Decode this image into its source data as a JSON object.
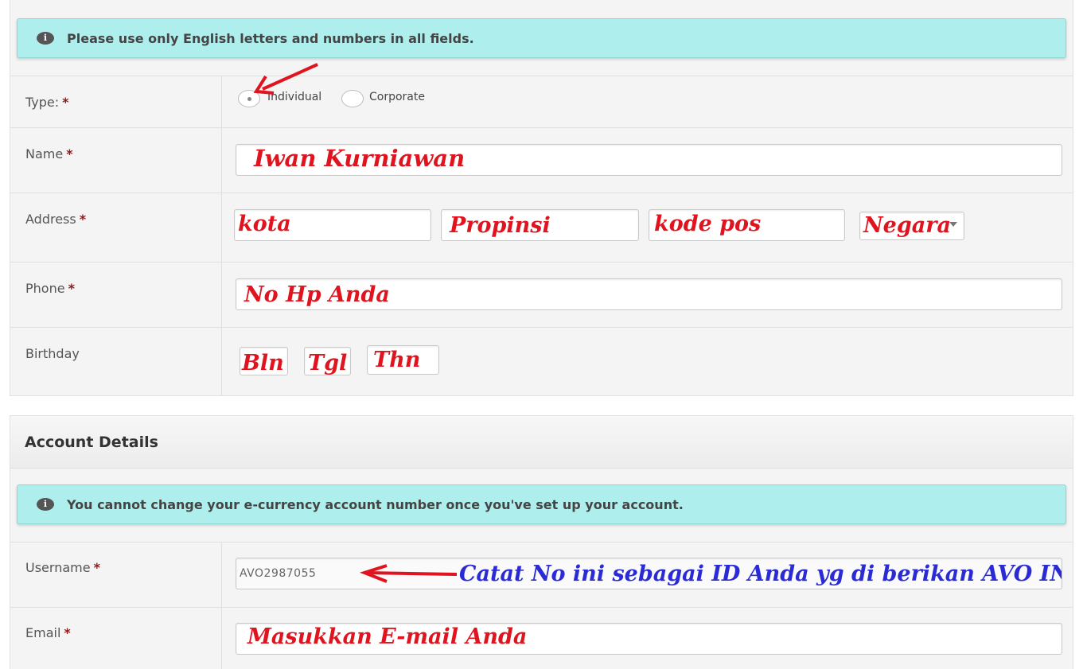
{
  "personal": {
    "notice": "Please use only English letters and numbers in all fields.",
    "type": {
      "label": "Type:",
      "options": [
        "Individual",
        "Corporate"
      ],
      "selected": "Individual"
    },
    "name": {
      "label": "Name",
      "value": "Iwan Kurniawan"
    },
    "address": {
      "label": "Address",
      "city": "kota",
      "province": "Propinsi",
      "postal_code": "kode pos",
      "country": "Negara"
    },
    "phone": {
      "label": "Phone",
      "value": "No Hp Anda"
    },
    "birthday": {
      "label": "Birthday",
      "month": "Bln",
      "day": "Tgl",
      "year": "Thn"
    }
  },
  "account": {
    "section_title": "Account Details",
    "notice": "You cannot change your e-currency account number once you've set up your account.",
    "username": {
      "label": "Username",
      "value": "AVO2987055",
      "annotation": "Catat No ini sebagai ID Anda yg di berikan AVO INC"
    },
    "email": {
      "label": "Email",
      "value": "Masukkan E-mail Anda"
    }
  },
  "required_mark": "*",
  "colors": {
    "notice_bg": "#aeeeec",
    "annotation_red": "#e0141e",
    "annotation_blue": "#2b2bd6",
    "required": "#8b1a1a"
  },
  "icons": [
    "info-icon",
    "info-icon",
    "red-arrow-icon",
    "red-arrow-icon",
    "chevron-down-icon"
  ]
}
